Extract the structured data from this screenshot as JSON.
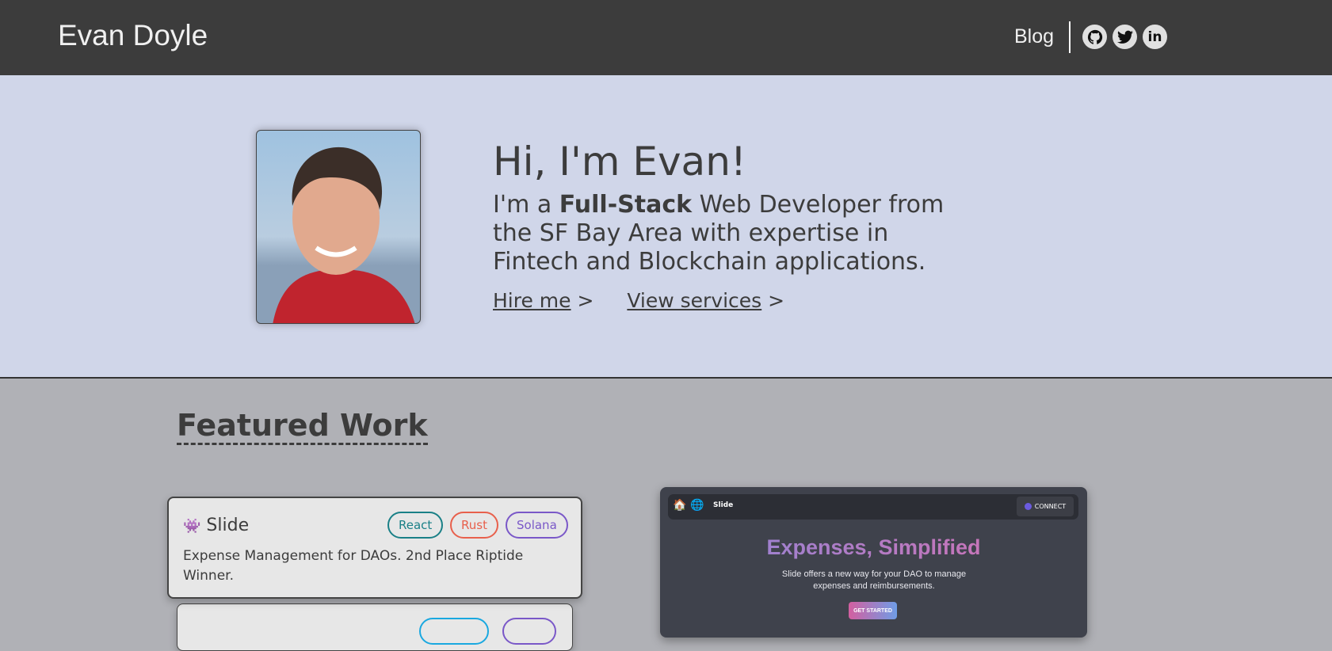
{
  "header": {
    "brand": "Evan Doyle",
    "blog": "Blog",
    "social": [
      "github-icon",
      "twitter-icon",
      "linkedin-icon"
    ]
  },
  "hero": {
    "greeting": "Hi, I'm Evan!",
    "intro_pre": "I'm a ",
    "intro_bold": "Full-Stack",
    "intro_post": " Web Developer from the SF Bay Area with expertise in Fintech and Blockchain applications.",
    "hire": "Hire me",
    "services": "View services",
    "arrow": ">"
  },
  "featured": {
    "title": "Featured Work",
    "cards": [
      {
        "emoji": "👾",
        "title": "Slide",
        "tags": [
          {
            "label": "React",
            "color": "#1a8087"
          },
          {
            "label": "Rust",
            "color": "#e8604c"
          },
          {
            "label": "Solana",
            "color": "#7a58c8"
          }
        ],
        "description": "Expense Management for DAOs. 2nd Place Riptide Winner."
      }
    ],
    "preview": {
      "app": "Slide",
      "connect": "CONNECT",
      "headline": "Expenses, Simplified",
      "subtitle": "Slide offers a new way for your DAO to manage expenses and reimbursements.",
      "cta": "GET STARTED"
    }
  }
}
